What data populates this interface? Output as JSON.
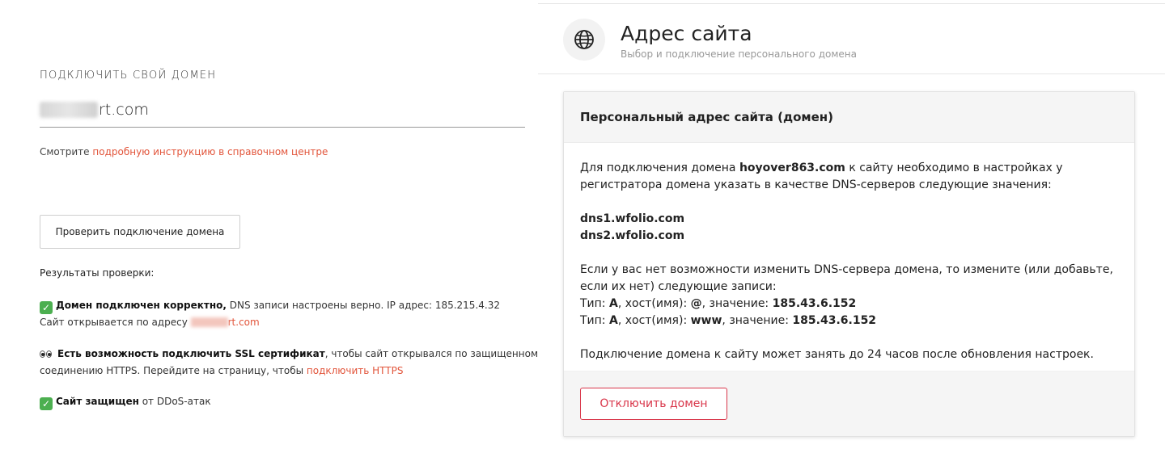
{
  "left": {
    "caption": "ПОДКЛЮЧИТЬ СВОЙ ДОМЕН",
    "domain_visible": "rt.com",
    "hint_text": "Смотрите ",
    "hint_link": "подробную инструкцию в справочном центре",
    "check_button": "Проверить подключение домена",
    "results_label": "Результаты проверки:",
    "result1": {
      "icon": "check-icon",
      "bold": "Домен подключен корректно,",
      "text": " DNS записи настроены верно. IP адрес: 185.215.4.32",
      "line2": "Сайт открывается по адресу ",
      "link": "rt.com"
    },
    "result2": {
      "icon": "eyes-icon",
      "bold": "Есть возможность подключить SSL сертификат",
      "text": ", чтобы сайт открывался по защищенному",
      "line2": "соединению HTTPS. Перейдите на страницу, чтобы ",
      "link": "подключить HTTPS"
    },
    "result3": {
      "icon": "check-icon",
      "bold": "Сайт защищен",
      "text": " от DDoS-атак"
    }
  },
  "right": {
    "icon": "globe-icon",
    "title": "Адрес сайта",
    "subtitle": "Выбор и подключение персонального домена",
    "card": {
      "title": "Персональный адрес сайта (домен)",
      "p1_a": "Для подключения домена ",
      "p1_domain": "hoyover863.com",
      "p1_b": " к сайту необходимо в настройках у регистратора домена указать в качестве DNS-серверов следующие значения:",
      "dns1": "dns1.wfolio.com",
      "dns2": "dns2.wfolio.com",
      "p2": "Если у вас нет возможности изменить DNS-сервера домена, то измените (или добавьте, если их нет) следующие записи:",
      "rec1_a": "Тип: ",
      "rec1_type": "A",
      "rec1_b": ", хост(имя): ",
      "rec1_host": "@",
      "rec1_c": ", значение: ",
      "rec1_value": "185.43.6.152",
      "rec2_a": "Тип: ",
      "rec2_type": "A",
      "rec2_b": ", хост(имя): ",
      "rec2_host": "www",
      "rec2_c": ", значение: ",
      "rec2_value": "185.43.6.152",
      "p3": "Подключение домена к сайту может занять до 24 часов после обновления настроек.",
      "disconnect_button": "Отключить домен"
    }
  },
  "colors": {
    "link": "#e2553b",
    "danger": "#d9364a",
    "success": "#4caf50"
  }
}
